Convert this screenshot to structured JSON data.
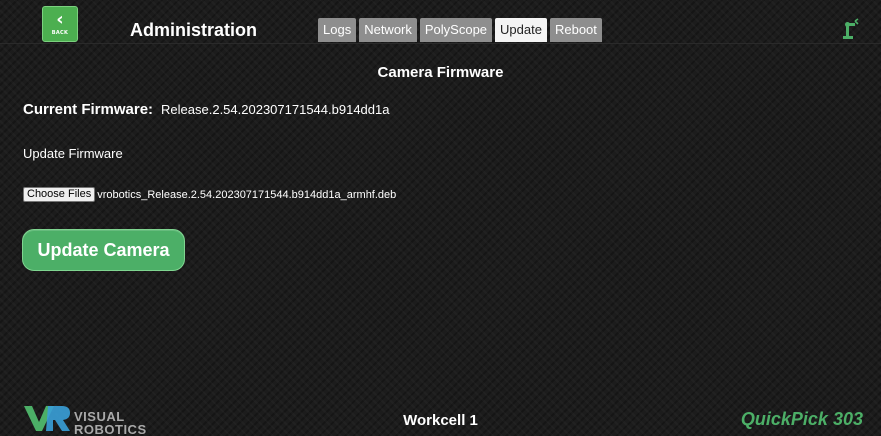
{
  "header": {
    "back_label": "BACK",
    "title": "Administration",
    "tabs": [
      {
        "label": "Logs",
        "active": false
      },
      {
        "label": "Network",
        "active": false
      },
      {
        "label": "PolyScope",
        "active": false
      },
      {
        "label": "Update",
        "active": true
      },
      {
        "label": "Reboot",
        "active": false
      }
    ],
    "robot_icon": "robot-arm-icon"
  },
  "main": {
    "section_title": "Camera Firmware",
    "current_firmware_label": "Current Firmware:",
    "current_firmware_value": "Release.2.54.202307171544.b914dd1a",
    "update_firmware_label": "Update Firmware",
    "choose_files_label": "Choose Files",
    "selected_file": "vrobotics_Release.2.54.202307171544.b914dd1a_armhf.deb",
    "update_button_label": "Update Camera"
  },
  "footer": {
    "logo_line1": "VISUAL",
    "logo_line2": "ROBOTICS",
    "workcell": "Workcell 1",
    "product_name": "QuickPick",
    "product_number": "303"
  },
  "colors": {
    "accent_green": "#4caf67",
    "background": "#1c1c1c",
    "tab_inactive": "#8e8e8e",
    "tab_active": "#f4f4f4"
  }
}
